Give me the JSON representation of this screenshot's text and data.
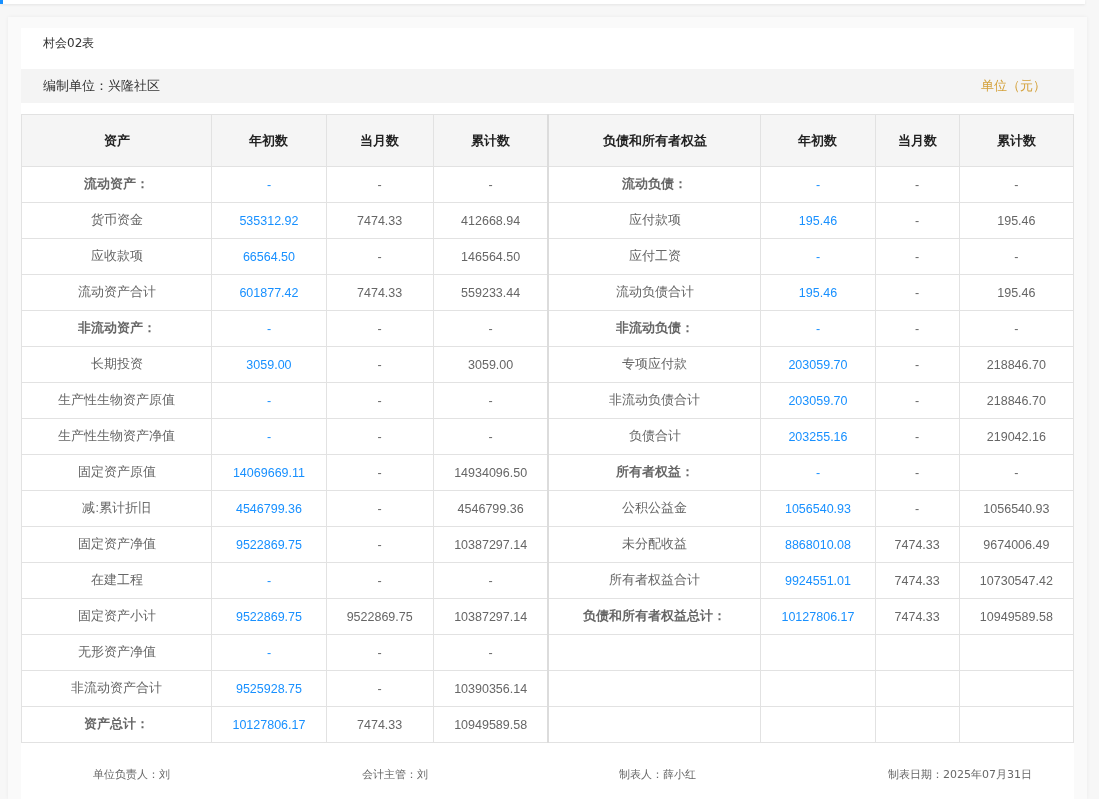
{
  "title": "村会02表",
  "info": {
    "unit": "编制单位：兴隆社区",
    "currency": "单位（元）"
  },
  "columns": [
    "资产",
    "年初数",
    "当月数",
    "累计数",
    "负债和所有者权益",
    "年初数",
    "当月数",
    "累计数"
  ],
  "rows": [
    {
      "left": {
        "label": "流动资产：",
        "bold": true,
        "start": "-",
        "month": "-",
        "total": "-"
      },
      "right": {
        "label": "流动负债：",
        "bold": true,
        "start": "-",
        "month": "-",
        "total": "-"
      }
    },
    {
      "left": {
        "label": "货币资金",
        "bold": false,
        "start": "535312.92",
        "month": "7474.33",
        "total": "412668.94"
      },
      "right": {
        "label": "应付款项",
        "bold": false,
        "start": "195.46",
        "month": "-",
        "total": "195.46"
      }
    },
    {
      "left": {
        "label": "应收款项",
        "bold": false,
        "start": "66564.50",
        "month": "-",
        "total": "146564.50"
      },
      "right": {
        "label": "应付工资",
        "bold": false,
        "start": "-",
        "month": "-",
        "total": "-"
      }
    },
    {
      "left": {
        "label": "流动资产合计",
        "bold": false,
        "start": "601877.42",
        "month": "7474.33",
        "total": "559233.44"
      },
      "right": {
        "label": "流动负债合计",
        "bold": false,
        "start": "195.46",
        "month": "-",
        "total": "195.46"
      }
    },
    {
      "left": {
        "label": "非流动资产：",
        "bold": true,
        "start": "-",
        "month": "-",
        "total": "-"
      },
      "right": {
        "label": "非流动负债：",
        "bold": true,
        "start": "-",
        "month": "-",
        "total": "-"
      }
    },
    {
      "left": {
        "label": "长期投资",
        "bold": false,
        "start": "3059.00",
        "month": "-",
        "total": "3059.00"
      },
      "right": {
        "label": "专项应付款",
        "bold": false,
        "start": "203059.70",
        "month": "-",
        "total": "218846.70"
      }
    },
    {
      "left": {
        "label": "生产性生物资产原值",
        "bold": false,
        "start": "-",
        "month": "-",
        "total": "-"
      },
      "right": {
        "label": "非流动负债合计",
        "bold": false,
        "start": "203059.70",
        "month": "-",
        "total": "218846.70"
      }
    },
    {
      "left": {
        "label": "生产性生物资产净值",
        "bold": false,
        "start": "-",
        "month": "-",
        "total": "-"
      },
      "right": {
        "label": "负债合计",
        "bold": false,
        "start": "203255.16",
        "month": "-",
        "total": "219042.16"
      }
    },
    {
      "left": {
        "label": "固定资产原值",
        "bold": false,
        "start": "14069669.11",
        "month": "-",
        "total": "14934096.50"
      },
      "right": {
        "label": "所有者权益：",
        "bold": true,
        "start": "-",
        "month": "-",
        "total": "-"
      }
    },
    {
      "left": {
        "label": "减:累计折旧",
        "bold": false,
        "start": "4546799.36",
        "month": "-",
        "total": "4546799.36"
      },
      "right": {
        "label": "公积公益金",
        "bold": false,
        "start": "1056540.93",
        "month": "-",
        "total": "1056540.93"
      }
    },
    {
      "left": {
        "label": "固定资产净值",
        "bold": false,
        "start": "9522869.75",
        "month": "-",
        "total": "10387297.14"
      },
      "right": {
        "label": "未分配收益",
        "bold": false,
        "start": "8868010.08",
        "month": "7474.33",
        "total": "9674006.49"
      }
    },
    {
      "left": {
        "label": "在建工程",
        "bold": false,
        "start": "-",
        "month": "-",
        "total": "-"
      },
      "right": {
        "label": "所有者权益合计",
        "bold": false,
        "start": "9924551.01",
        "month": "7474.33",
        "total": "10730547.42"
      }
    },
    {
      "left": {
        "label": "固定资产小计",
        "bold": false,
        "start": "9522869.75",
        "month": "9522869.75",
        "total": "10387297.14"
      },
      "right": {
        "label": "负债和所有者权益总计：",
        "bold": true,
        "start": "10127806.17",
        "month": "7474.33",
        "total": "10949589.58"
      }
    },
    {
      "left": {
        "label": "无形资产净值",
        "bold": false,
        "start": "-",
        "month": "-",
        "total": "-"
      }
    },
    {
      "left": {
        "label": "非流动资产合计",
        "bold": false,
        "start": "9525928.75",
        "month": "-",
        "total": "10390356.14"
      }
    },
    {
      "left": {
        "label": "资产总计：",
        "bold": true,
        "start": "10127806.17",
        "month": "7474.33",
        "total": "10949589.58"
      }
    }
  ],
  "footer": [
    "单位负责人：刘",
    "会计主管：刘",
    "制表人：薛小红",
    "制表日期：2025年07月31日"
  ]
}
